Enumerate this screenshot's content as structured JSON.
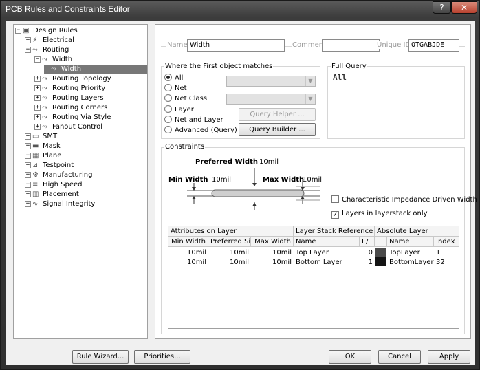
{
  "window": {
    "title": "PCB Rules and Constraints Editor",
    "help_label": "?",
    "close_label": "✕"
  },
  "tree": {
    "items": [
      {
        "label": "Design Rules",
        "exp": "⊟",
        "icon": "▣"
      },
      {
        "label": "Electrical",
        "exp": "⊞",
        "icon": "⚡"
      },
      {
        "label": "Routing",
        "exp": "⊟",
        "icon": "⤳"
      },
      {
        "label": "Width",
        "exp": "⊟",
        "icon": "⤳"
      },
      {
        "label": "Width",
        "exp": "",
        "icon": "⤳"
      },
      {
        "label": "Routing Topology",
        "exp": "⊞",
        "icon": "⤳"
      },
      {
        "label": "Routing Priority",
        "exp": "⊞",
        "icon": "⤳"
      },
      {
        "label": "Routing Layers",
        "exp": "⊞",
        "icon": "⤳"
      },
      {
        "label": "Routing Corners",
        "exp": "⊞",
        "icon": "⤳"
      },
      {
        "label": "Routing Via Style",
        "exp": "⊞",
        "icon": "⤳"
      },
      {
        "label": "Fanout Control",
        "exp": "⊞",
        "icon": "⤳"
      },
      {
        "label": "SMT",
        "exp": "⊞",
        "icon": "▭"
      },
      {
        "label": "Mask",
        "exp": "⊞",
        "icon": "▬"
      },
      {
        "label": "Plane",
        "exp": "⊞",
        "icon": "▦"
      },
      {
        "label": "Testpoint",
        "exp": "⊞",
        "icon": "⊿"
      },
      {
        "label": "Manufacturing",
        "exp": "⊞",
        "icon": "⚙"
      },
      {
        "label": "High Speed",
        "exp": "⊞",
        "icon": "≡"
      },
      {
        "label": "Placement",
        "exp": "⊞",
        "icon": "▥"
      },
      {
        "label": "Signal Integrity",
        "exp": "⊞",
        "icon": "∿"
      }
    ]
  },
  "rule": {
    "name_label": "Name",
    "name_value": "Width",
    "comment_label": "Comment",
    "comment_value": "",
    "uid_label": "Unique ID",
    "uid_value": "QTGABJDE"
  },
  "match": {
    "title": "Where the First object matches",
    "options": [
      "All",
      "Net",
      "Net Class",
      "Layer",
      "Net and Layer",
      "Advanced (Query)"
    ],
    "selected": "All",
    "query_helper": "Query Helper ...",
    "query_builder": "Query Builder ..."
  },
  "full_query": {
    "title": "Full Query",
    "text": "All"
  },
  "constraints": {
    "title": "Constraints",
    "preferred_label": "Preferred Width",
    "preferred_value": "10mil",
    "min_label": "Min Width",
    "min_value": "10mil",
    "max_label": "Max Width",
    "max_value": "10mil",
    "char_impedance_label": "Characteristic Impedance Driven Width",
    "char_impedance_checked": false,
    "layers_only_label": "Layers in layerstack only",
    "layers_only_checked": true
  },
  "table": {
    "group_headers": [
      "Attributes on Layer",
      "Layer Stack Reference",
      "Absolute Layer"
    ],
    "columns": [
      "Min Width",
      "Preferred Si...",
      "Max Width",
      "Name",
      "I /",
      "",
      "Name",
      "Index"
    ],
    "rows": [
      {
        "min": "10mil",
        "pref": "10mil",
        "max": "10mil",
        "name": "Top Layer",
        "idx": "0",
        "color": "#4a4a4a",
        "abs_name": "TopLayer",
        "abs_index": "1"
      },
      {
        "min": "10mil",
        "pref": "10mil",
        "max": "10mil",
        "name": "Bottom Layer",
        "idx": "1",
        "color": "#141414",
        "abs_name": "BottomLayer",
        "abs_index": "32"
      }
    ]
  },
  "buttons": {
    "rule_wizard": "Rule Wizard...",
    "priorities": "Priorities...",
    "ok": "OK",
    "cancel": "Cancel",
    "apply": "Apply"
  }
}
